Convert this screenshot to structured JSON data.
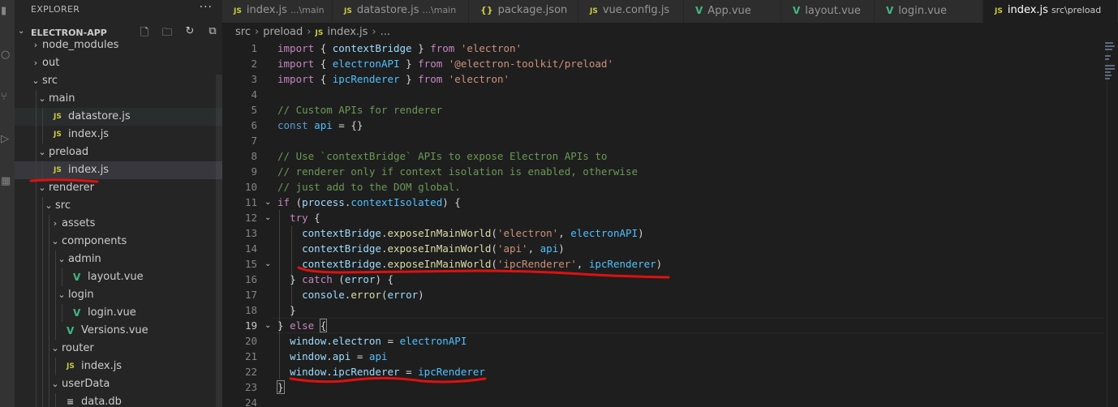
{
  "sidebar": {
    "header": "EXPLORER",
    "more": "···",
    "project": "ELECTRON-APP",
    "tree": [
      {
        "label": "node_modules",
        "type": "folder",
        "depth": 0,
        "open": false
      },
      {
        "label": "out",
        "type": "folder",
        "depth": 0,
        "open": false
      },
      {
        "label": "src",
        "type": "folder",
        "depth": 0,
        "open": true
      },
      {
        "label": "main",
        "type": "folder",
        "depth": 1,
        "open": true
      },
      {
        "label": "datastore.js",
        "type": "js",
        "depth": 2
      },
      {
        "label": "index.js",
        "type": "js",
        "depth": 2
      },
      {
        "label": "preload",
        "type": "folder",
        "depth": 1,
        "open": true
      },
      {
        "label": "index.js",
        "type": "js",
        "depth": 2,
        "selected": true
      },
      {
        "label": "renderer",
        "type": "folder",
        "depth": 1,
        "open": true
      },
      {
        "label": "src",
        "type": "folder",
        "depth": 2,
        "open": true
      },
      {
        "label": "assets",
        "type": "folder",
        "depth": 3,
        "open": false
      },
      {
        "label": "components",
        "type": "folder",
        "depth": 3,
        "open": true
      },
      {
        "label": "admin",
        "type": "folder",
        "depth": 4,
        "open": true
      },
      {
        "label": "layout.vue",
        "type": "vue",
        "depth": 5
      },
      {
        "label": "login",
        "type": "folder",
        "depth": 4,
        "open": true
      },
      {
        "label": "login.vue",
        "type": "vue",
        "depth": 5
      },
      {
        "label": "Versions.vue",
        "type": "vue",
        "depth": 4
      },
      {
        "label": "router",
        "type": "folder",
        "depth": 3,
        "open": true
      },
      {
        "label": "index.js",
        "type": "js",
        "depth": 4
      },
      {
        "label": "userData",
        "type": "folder",
        "depth": 3,
        "open": true
      },
      {
        "label": "data.db",
        "type": "db",
        "depth": 4
      }
    ]
  },
  "tabs": [
    {
      "label": "index.js",
      "desc": "...\\main",
      "icon": "js"
    },
    {
      "label": "datastore.js",
      "desc": "...\\main",
      "icon": "js"
    },
    {
      "label": "package.json",
      "desc": "",
      "icon": "json"
    },
    {
      "label": "vue.config.js",
      "desc": "",
      "icon": "js"
    },
    {
      "label": "App.vue",
      "desc": "",
      "icon": "vue"
    },
    {
      "label": "layout.vue",
      "desc": "",
      "icon": "vue"
    },
    {
      "label": "login.vue",
      "desc": "",
      "icon": "vue"
    },
    {
      "label": "index.js",
      "desc": "src\\preload",
      "icon": "js",
      "active": true
    }
  ],
  "breadcrumb": [
    "src",
    "preload",
    "index.js",
    "..."
  ],
  "icons": {
    "js": "JS",
    "json": "{}",
    "vue": "V",
    "db": "≡"
  },
  "editor": {
    "current_line": 19,
    "lines": [
      "import { contextBridge } from 'electron'",
      "import { electronAPI } from '@electron-toolkit/preload'",
      "import { ipcRenderer } from 'electron'",
      "",
      "// Custom APIs for renderer",
      "const api = {}",
      "",
      "// Use `contextBridge` APIs to expose Electron APIs to",
      "// renderer only if context isolation is enabled, otherwise",
      "// just add to the DOM global.",
      "if (process.contextIsolated) {",
      "  try {",
      "    contextBridge.exposeInMainWorld('electron', electronAPI)",
      "    contextBridge.exposeInMainWorld('api', api)",
      "    contextBridge.exposeInMainWorld('ipcRenderer', ipcRenderer)",
      "  } catch (error) {",
      "    console.error(error)",
      "  }",
      "} else {",
      "  window.electron = electronAPI",
      "  window.api = api",
      "  window.ipcRenderer = ipcRenderer",
      "}",
      ""
    ]
  },
  "colors": {
    "keyword": "#c586c0",
    "storage": "#569cd6",
    "variable": "#9cdcfe",
    "string": "#ce9178",
    "function": "#dcdcaa",
    "comment": "#6a9955",
    "constant": "#4fc1ff",
    "annotation": "#e01010"
  }
}
